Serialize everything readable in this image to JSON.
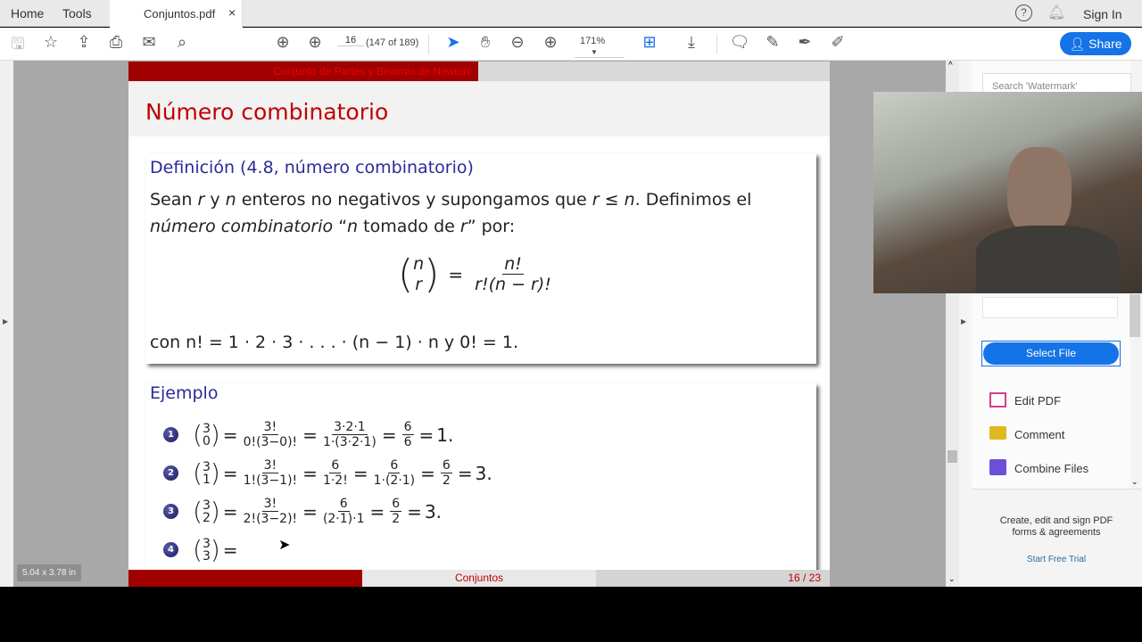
{
  "tabs": {
    "home": "Home",
    "tools": "Tools",
    "doc": "Conjuntos.pdf",
    "close": "×"
  },
  "header_right": {
    "sign_in": "Sign In"
  },
  "toolbar": {
    "page_input": "16",
    "page_of": "(147 of 189)",
    "zoom": "171%",
    "share": "Share"
  },
  "slide": {
    "header_section": "Conjunto de Partes y Binomio de Newton",
    "title": "Número combinatorio",
    "definition_title": "Definición (4.8, número combinatorio)",
    "def_line1_a": "Sean ",
    "def_r": "r",
    "def_y": " y ",
    "def_n": "n",
    "def_line1_b": " enteros no negativos y supongamos que ",
    "def_rlen": "r ≤ n",
    "def_line1_c": ". Definimos el",
    "def_line2_a": "número combinatorio",
    "def_line2_b": " “",
    "def_line2_n": "n",
    "def_line2_c": " tomado de ",
    "def_line2_r": "r",
    "def_line2_d": "” por:",
    "formula": {
      "top": "n",
      "bottom": "r",
      "eq": "=",
      "num": "n!",
      "den": "r!(n − r)!"
    },
    "con_line": "con n! = 1 · 2 · 3 · . . . · (n − 1) · n y 0! = 1.",
    "example_title": "Ejemplo",
    "examples": [
      {
        "bullet": "1",
        "top": "3",
        "bottom": "0",
        "parts": [
          {
            "num": "3!",
            "den": "0!(3−0)!"
          },
          {
            "num": "3·2·1",
            "den": "1·(3·2·1)"
          },
          {
            "num": "6",
            "den": "6"
          }
        ],
        "result": "1."
      },
      {
        "bullet": "2",
        "top": "3",
        "bottom": "1",
        "parts": [
          {
            "num": "3!",
            "den": "1!(3−1)!"
          },
          {
            "num": "6",
            "den": "1·2!"
          },
          {
            "num": "6",
            "den": "1·(2·1)"
          },
          {
            "num": "6",
            "den": "2"
          }
        ],
        "result": "3."
      },
      {
        "bullet": "3",
        "top": "3",
        "bottom": "2",
        "parts": [
          {
            "num": "3!",
            "den": "2!(3−2)!"
          },
          {
            "num": "6",
            "den": "(2·1)·1"
          },
          {
            "num": "6",
            "den": "2"
          }
        ],
        "result": "3."
      },
      {
        "bullet": "4",
        "top": "3",
        "bottom": "3",
        "parts": [],
        "result": ""
      }
    ],
    "footer_center": "Conjuntos",
    "footer_page": "16 / 23"
  },
  "page_size": "5.04 x 3.78 in",
  "right_panel": {
    "search_placeholder": "Search 'Watermark'",
    "select_file": "Select File",
    "tools": [
      {
        "label": "Edit PDF",
        "color": "#d4418e"
      },
      {
        "label": "Comment",
        "color": "#e0b820"
      },
      {
        "label": "Combine Files",
        "color": "#6b4fd8"
      }
    ],
    "promo": "Create, edit and sign PDF forms & agreements",
    "trial": "Start Free Trial"
  },
  "colors": {
    "accent": "#1473e6",
    "slide_red": "#a00000",
    "title_red": "#c00000",
    "block_blue": "#2a2a9a"
  }
}
